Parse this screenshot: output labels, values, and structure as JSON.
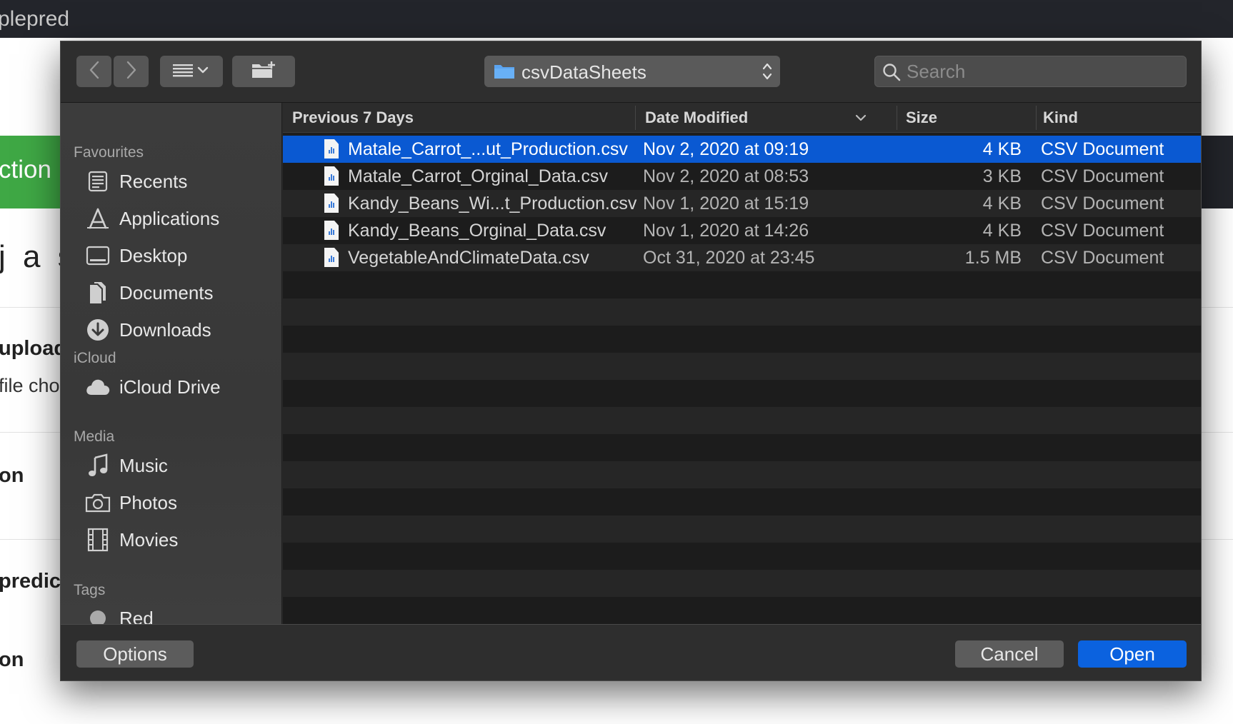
{
  "background": {
    "app_title": "plepred",
    "banner_text": "ction",
    "text_1": "j a s",
    "text_2": "upload",
    "text_3": "file cho",
    "text_4": "on",
    "text_5": "predict",
    "text_6": "on"
  },
  "toolbar": {
    "back_icon": "chevron-left-icon",
    "forward_icon": "chevron-right-icon",
    "view_icon": "list-view-icon",
    "new_folder_icon": "new-folder-icon",
    "path_popup": "csvDataSheets",
    "search_placeholder": "Search"
  },
  "sidebar": {
    "sections": [
      {
        "title": "Favourites",
        "items": [
          {
            "label": "Recents",
            "icon": "recents-icon"
          },
          {
            "label": "Applications",
            "icon": "applications-icon"
          },
          {
            "label": "Desktop",
            "icon": "desktop-icon"
          },
          {
            "label": "Documents",
            "icon": "documents-icon"
          },
          {
            "label": "Downloads",
            "icon": "downloads-icon"
          }
        ]
      },
      {
        "title": "iCloud",
        "items": [
          {
            "label": "iCloud Drive",
            "icon": "cloud-icon"
          }
        ]
      },
      {
        "title": "Media",
        "items": [
          {
            "label": "Music",
            "icon": "music-icon"
          },
          {
            "label": "Photos",
            "icon": "camera-icon"
          },
          {
            "label": "Movies",
            "icon": "film-icon"
          }
        ]
      },
      {
        "title": "Tags",
        "items": [
          {
            "label": "Red",
            "icon": "tag-dot-icon"
          }
        ]
      }
    ]
  },
  "file_list": {
    "columns": {
      "name": "Previous 7 Days",
      "date": "Date Modified",
      "size": "Size",
      "kind": "Kind"
    },
    "files": [
      {
        "name": "Matale_Carrot_...ut_Production.csv",
        "date": "Nov 2, 2020 at 09:19",
        "size": "4 KB",
        "kind": "CSV Document",
        "selected": true
      },
      {
        "name": "Matale_Carrot_Orginal_Data.csv",
        "date": "Nov 2, 2020 at 08:53",
        "size": "3 KB",
        "kind": "CSV Document",
        "selected": false
      },
      {
        "name": "Kandy_Beans_Wi...t_Production.csv",
        "date": "Nov 1, 2020 at 15:19",
        "size": "4 KB",
        "kind": "CSV Document",
        "selected": false
      },
      {
        "name": "Kandy_Beans_Orginal_Data.csv",
        "date": "Nov 1, 2020 at 14:26",
        "size": "4 KB",
        "kind": "CSV Document",
        "selected": false
      },
      {
        "name": "VegetableAndClimateData.csv",
        "date": "Oct 31, 2020 at 23:45",
        "size": "1.5 MB",
        "kind": "CSV Document",
        "selected": false
      }
    ]
  },
  "buttons": {
    "options": "Options",
    "cancel": "Cancel",
    "open": "Open"
  },
  "colors": {
    "accent": "#0b62df",
    "selection": "#0a59d2",
    "tag_red": "#aaaaaa"
  }
}
